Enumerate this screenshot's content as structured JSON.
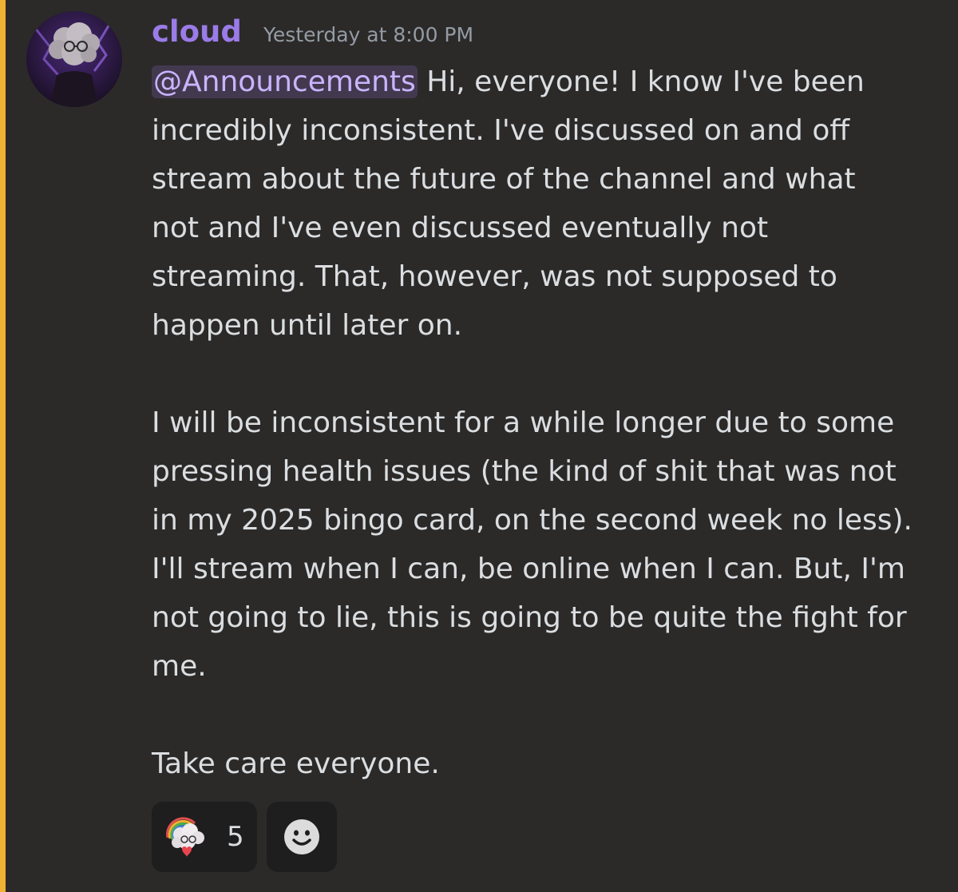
{
  "message": {
    "author": "cloud",
    "timestamp": "Yesterday at 8:00 PM",
    "mention": "@Announcements",
    "first_line_rest": "Hi, everyone! I know I've been",
    "lines_p1": [
      "incredibly inconsistent. I've discussed on and off",
      "stream about the future of the channel and what",
      "not and I've even discussed eventually not",
      "streaming. That, however, was not supposed to",
      "happen until later on."
    ],
    "lines_p2": [
      "I will be inconsistent for a while longer due to some",
      "pressing health issues (the kind of shit that was not",
      "in my 2025 bingo card, on the second week no less).",
      "I'll stream when I can, be online when I can. But, I'm",
      "not going to lie, this is going to be quite the fight for",
      "me."
    ],
    "closing": "Take care everyone."
  },
  "reactions": [
    {
      "emoji": "cloud-heart-emoji",
      "count": "5"
    }
  ],
  "add_reaction_icon": "smiley-face-icon",
  "colors": {
    "background": "#2b2a29",
    "highlight_bar": "#f0b232",
    "username": "#9b7be8",
    "mention_text": "#c9b4ff",
    "text": "#dbdee1",
    "timestamp": "#949ba4"
  }
}
